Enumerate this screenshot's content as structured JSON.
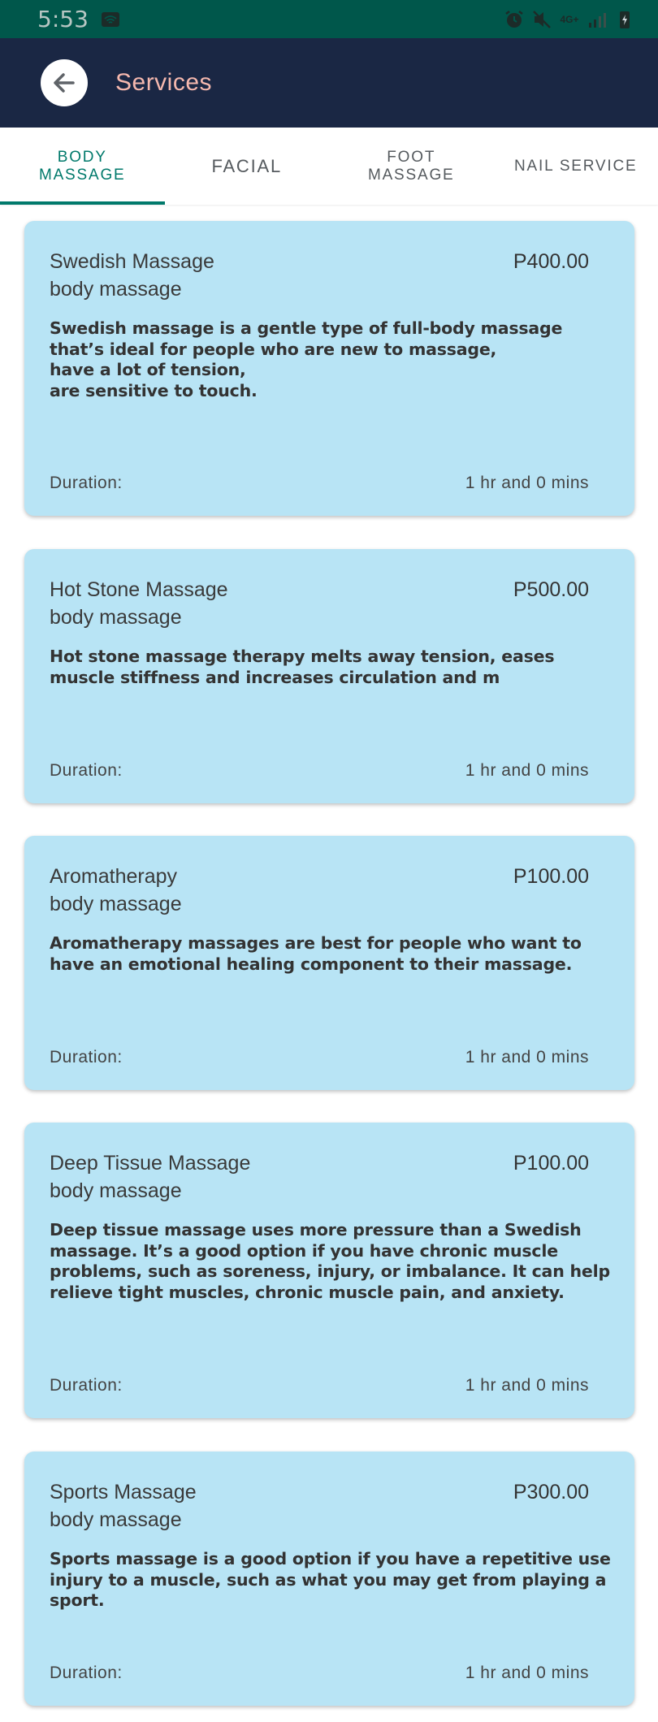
{
  "status_bar": {
    "time": "5:53",
    "network": "4G+"
  },
  "app_bar": {
    "title": "Services"
  },
  "tabs": [
    {
      "label": "Body\nMassage",
      "active": true
    },
    {
      "label": "Facial",
      "active": false
    },
    {
      "label": "Foot\nMassage",
      "active": false
    },
    {
      "label": "Nail Service",
      "active": false
    }
  ],
  "services": [
    {
      "name": "Swedish Massage",
      "category": "body massage",
      "price": "P400.00",
      "description": "Swedish massage is a gentle type of full-body massage that’s ideal for people who are new to massage,\nhave a lot of tension,\nare sensitive to touch.",
      "duration_label": "Duration:",
      "duration_value": "1 hr and 0 mins"
    },
    {
      "name": "Hot Stone Massage",
      "category": "body massage",
      "price": "P500.00",
      "description": "Hot stone massage therapy melts away tension, eases muscle stiffness and increases circulation and m",
      "duration_label": "Duration:",
      "duration_value": "1 hr and 0 mins"
    },
    {
      "name": "Aromatherapy",
      "category": "body massage",
      "price": "P100.00",
      "description": "Aromatherapy massages are best for people who want to have an emotional healing component to their massage.",
      "duration_label": "Duration:",
      "duration_value": "1 hr and 0 mins"
    },
    {
      "name": "Deep Tissue Massage",
      "category": "body massage",
      "price": "P100.00",
      "description": "Deep tissue massage uses more pressure than a Swedish massage. It’s a good option if you have chronic muscle problems, such as soreness, injury, or imbalance. It can help relieve tight muscles, chronic muscle pain, and anxiety.",
      "duration_label": "Duration:",
      "duration_value": "1 hr and 0 mins"
    },
    {
      "name": "Sports Massage",
      "category": "body massage",
      "price": "P300.00",
      "description": "Sports massage is a good option if you have a repetitive use injury to a muscle, such as what you may get from playing a sport.",
      "duration_label": "Duration:",
      "duration_value": "1 hr and 0 mins"
    }
  ],
  "colors": {
    "status_bar": "#00574b",
    "app_bar": "#1a2744",
    "title": "#f5b8ae",
    "tab_active": "#00796b",
    "card": "#b8e4f5"
  }
}
